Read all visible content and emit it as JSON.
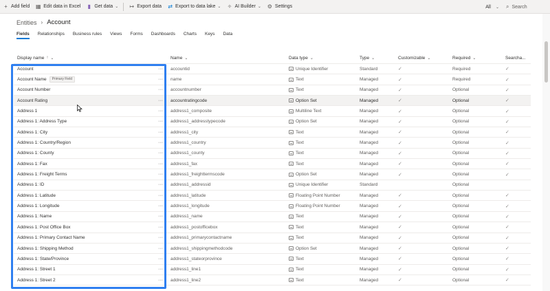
{
  "commandbar": {
    "add_field": "Add field",
    "edit_excel": "Edit data in Excel",
    "get_data": "Get data",
    "export_data": "Export data",
    "export_lake": "Export to data lake",
    "ai_builder": "AI Builder",
    "settings": "Settings",
    "view_filter": "All",
    "search_placeholder": "Search",
    "icons": {
      "add": "plus-icon",
      "excel": "excel-icon",
      "get_data": "database-icon",
      "export": "export-icon",
      "lake": "data-lake-icon",
      "ai": "ai-builder-icon",
      "settings": "gear-icon",
      "search": "search-icon"
    }
  },
  "breadcrumb": {
    "parent": "Entities",
    "current": "Account"
  },
  "tabs": [
    "Fields",
    "Relationships",
    "Business rules",
    "Views",
    "Forms",
    "Dashboards",
    "Charts",
    "Keys",
    "Data"
  ],
  "table": {
    "headers": {
      "display_name": "Display name",
      "sort_indicator": "↑",
      "name": "Name",
      "data_type": "Data type",
      "type": "Type",
      "customizable": "Customizable",
      "required": "Required",
      "searchable": "Searcha..."
    },
    "primary_tag": "Primary Field",
    "more_glyph": "···",
    "check_glyph": "✓",
    "rows": [
      {
        "display": "Account",
        "name": "accountid",
        "data_type": "Unique Identifier",
        "type": "Standard",
        "customizable": true,
        "required": "Required",
        "searchable": true
      },
      {
        "display": "Account Name",
        "primary": true,
        "name": "name",
        "data_type": "Text",
        "type": "Managed",
        "customizable": true,
        "required": "Required",
        "searchable": true
      },
      {
        "display": "Account Number",
        "name": "accountnumber",
        "data_type": "Text",
        "type": "Managed",
        "customizable": true,
        "required": "Optional",
        "searchable": true
      },
      {
        "display": "Account Rating",
        "name": "accountratingcode",
        "data_type": "Option Set",
        "type": "Managed",
        "customizable": true,
        "required": "Optional",
        "searchable": true
      },
      {
        "display": "Address 1",
        "name": "address1_composite",
        "data_type": "Multiline Text",
        "type": "Managed",
        "customizable": true,
        "required": "Optional",
        "searchable": true
      },
      {
        "display": "Address 1: Address Type",
        "name": "address1_addresstypecode",
        "data_type": "Option Set",
        "type": "Managed",
        "customizable": true,
        "required": "Optional",
        "searchable": true
      },
      {
        "display": "Address 1: City",
        "name": "address1_city",
        "data_type": "Text",
        "type": "Managed",
        "customizable": true,
        "required": "Optional",
        "searchable": true
      },
      {
        "display": "Address 1: Country/Region",
        "name": "address1_country",
        "data_type": "Text",
        "type": "Managed",
        "customizable": true,
        "required": "Optional",
        "searchable": true
      },
      {
        "display": "Address 1: County",
        "name": "address1_county",
        "data_type": "Text",
        "type": "Managed",
        "customizable": true,
        "required": "Optional",
        "searchable": true
      },
      {
        "display": "Address 1: Fax",
        "name": "address1_fax",
        "data_type": "Text",
        "type": "Managed",
        "customizable": true,
        "required": "Optional",
        "searchable": true
      },
      {
        "display": "Address 1: Freight Terms",
        "name": "address1_freighttermscode",
        "data_type": "Option Set",
        "type": "Managed",
        "customizable": true,
        "required": "Optional",
        "searchable": true
      },
      {
        "display": "Address 1: ID",
        "name": "address1_addressid",
        "data_type": "Unique Identifier",
        "type": "Standard",
        "customizable": false,
        "required": "Optional",
        "searchable": false
      },
      {
        "display": "Address 1: Latitude",
        "name": "address1_latitude",
        "data_type": "Floating Point Number",
        "type": "Managed",
        "customizable": true,
        "required": "Optional",
        "searchable": true
      },
      {
        "display": "Address 1: Longitude",
        "name": "address1_longitude",
        "data_type": "Floating Point Number",
        "type": "Managed",
        "customizable": true,
        "required": "Optional",
        "searchable": true
      },
      {
        "display": "Address 1: Name",
        "name": "address1_name",
        "data_type": "Text",
        "type": "Managed",
        "customizable": true,
        "required": "Optional",
        "searchable": true
      },
      {
        "display": "Address 1: Post Office Box",
        "name": "address1_postofficebox",
        "data_type": "Text",
        "type": "Managed",
        "customizable": true,
        "required": "Optional",
        "searchable": true
      },
      {
        "display": "Address 1: Primary Contact Name",
        "name": "address1_primarycontactname",
        "data_type": "Text",
        "type": "Managed",
        "customizable": true,
        "required": "Optional",
        "searchable": true
      },
      {
        "display": "Address 1: Shipping Method",
        "name": "address1_shippingmethodcode",
        "data_type": "Option Set",
        "type": "Managed",
        "customizable": true,
        "required": "Optional",
        "searchable": true
      },
      {
        "display": "Address 1: State/Province",
        "name": "address1_stateorprovince",
        "data_type": "Text",
        "type": "Managed",
        "customizable": true,
        "required": "Optional",
        "searchable": true
      },
      {
        "display": "Address 1: Street 1",
        "name": "address1_line1",
        "data_type": "Text",
        "type": "Managed",
        "customizable": true,
        "required": "Optional",
        "searchable": true
      },
      {
        "display": "Address 1: Street 2",
        "name": "address1_line2",
        "data_type": "Text",
        "type": "Managed",
        "customizable": true,
        "required": "Optional",
        "searchable": true
      }
    ]
  },
  "colors": {
    "accent": "#0078d4",
    "highlight_box": "#2f7ff0"
  }
}
